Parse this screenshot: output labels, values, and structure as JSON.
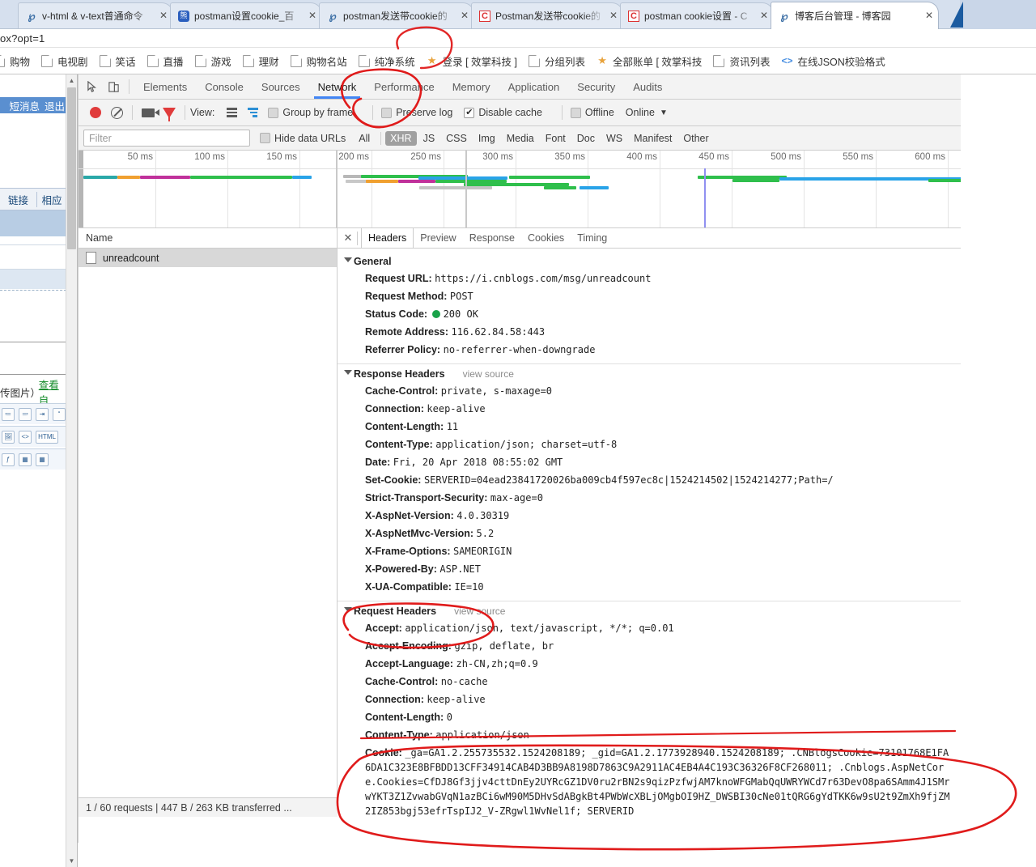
{
  "browser": {
    "tabs": [
      {
        "title": "v-html & v-text普通命令",
        "favicon": "ie-icon",
        "active": false
      },
      {
        "title": "postman设置cookie_百",
        "favicon": "baidu-icon",
        "active": false
      },
      {
        "title": "postman发送带cookie的",
        "favicon": "ie-icon",
        "active": false
      },
      {
        "title": "Postman发送带cookie的",
        "favicon": "csdn-icon",
        "active": false
      },
      {
        "title": "postman cookie设置 - C",
        "favicon": "csdn-icon",
        "active": false
      },
      {
        "title": "博客后台管理 - 博客园",
        "favicon": "ie-icon",
        "active": true
      }
    ],
    "omnibar": {
      "value": "ox?opt=1"
    },
    "bookmarks": [
      {
        "label": "购物",
        "icon": "page-icon"
      },
      {
        "label": "电视剧",
        "icon": "page-icon"
      },
      {
        "label": "笑话",
        "icon": "page-icon"
      },
      {
        "label": "直播",
        "icon": "page-icon"
      },
      {
        "label": "游戏",
        "icon": "page-icon"
      },
      {
        "label": "理财",
        "icon": "page-icon"
      },
      {
        "label": "购物名站",
        "icon": "page-icon"
      },
      {
        "label": "纯净系统",
        "icon": "page-icon"
      },
      {
        "label": "登录 [ 效掌科技 ]",
        "icon": "star-icon"
      },
      {
        "label": "分组列表",
        "icon": "page-icon"
      },
      {
        "label": "全部账单 [ 效掌科技",
        "icon": "star-icon"
      },
      {
        "label": "资讯列表",
        "icon": "page-icon"
      },
      {
        "label": "在线JSON校验格式",
        "icon": "code-icon"
      }
    ]
  },
  "page_behind": {
    "topbar_items": [
      "短消息",
      "退出"
    ],
    "table_headers": [
      "链接",
      "相应"
    ],
    "editor_hint": "传图片）",
    "editor_link": "查看自",
    "editor_tool_labels": [
      "HTML"
    ]
  },
  "devtools": {
    "panel_tabs": [
      {
        "label": "Elements",
        "active": false
      },
      {
        "label": "Console",
        "active": false
      },
      {
        "label": "Sources",
        "active": false
      },
      {
        "label": "Network",
        "active": true
      },
      {
        "label": "Performance",
        "active": false
      },
      {
        "label": "Memory",
        "active": false
      },
      {
        "label": "Application",
        "active": false
      },
      {
        "label": "Security",
        "active": false
      },
      {
        "label": "Audits",
        "active": false
      }
    ],
    "toolbar": {
      "record_label": "record-button",
      "clear_label": "clear-button",
      "capture_screenshots_label": "camera-button",
      "filter_toggle_label": "filter-button",
      "view_label": "View:",
      "group_by_frame": "Group by frame",
      "group_by_frame_checked": false,
      "preserve_log": "Preserve log",
      "preserve_log_checked": false,
      "disable_cache": "Disable cache",
      "disable_cache_checked": true,
      "offline": "Offline",
      "offline_checked": false,
      "throttling": "Online"
    },
    "filterbar": {
      "filter_placeholder": "Filter",
      "filter_value": "",
      "hide_data_urls": "Hide data URLs",
      "hide_data_urls_checked": false,
      "types": [
        {
          "label": "All",
          "active": false
        },
        {
          "label": "XHR",
          "active": true
        },
        {
          "label": "JS",
          "active": false
        },
        {
          "label": "CSS",
          "active": false
        },
        {
          "label": "Img",
          "active": false
        },
        {
          "label": "Media",
          "active": false
        },
        {
          "label": "Font",
          "active": false
        },
        {
          "label": "Doc",
          "active": false
        },
        {
          "label": "WS",
          "active": false
        },
        {
          "label": "Manifest",
          "active": false
        },
        {
          "label": "Other",
          "active": false
        }
      ]
    },
    "overview": {
      "ticks": [
        "50 ms",
        "100 ms",
        "150 ms",
        "200 ms",
        "250 ms",
        "300 ms",
        "350 ms",
        "400 ms",
        "450 ms",
        "500 ms",
        "550 ms",
        "600 ms"
      ]
    },
    "request_list": {
      "column_header": "Name",
      "rows": [
        {
          "name": "unreadcount",
          "selected": true
        }
      ],
      "status_text": "1 / 60 requests  |  447 B / 263 KB transferred  ..."
    },
    "detail_tabs": [
      {
        "label": "Headers",
        "active": true
      },
      {
        "label": "Preview",
        "active": false
      },
      {
        "label": "Response",
        "active": false
      },
      {
        "label": "Cookies",
        "active": false
      },
      {
        "label": "Timing",
        "active": false
      }
    ],
    "headers": {
      "general_title": "General",
      "general": [
        {
          "name": "Request URL:",
          "value": "https://i.cnblogs.com/msg/unreadcount"
        },
        {
          "name": "Request Method:",
          "value": "POST"
        },
        {
          "name": "Status Code:",
          "value": "200 OK",
          "dot": true
        },
        {
          "name": "Remote Address:",
          "value": "116.62.84.58:443"
        },
        {
          "name": "Referrer Policy:",
          "value": "no-referrer-when-downgrade"
        }
      ],
      "response_title": "Response Headers",
      "response_viewsource": "view source",
      "response": [
        {
          "name": "Cache-Control:",
          "value": "private, s-maxage=0"
        },
        {
          "name": "Connection:",
          "value": "keep-alive"
        },
        {
          "name": "Content-Length:",
          "value": "11"
        },
        {
          "name": "Content-Type:",
          "value": "application/json; charset=utf-8"
        },
        {
          "name": "Date:",
          "value": "Fri, 20 Apr 2018 08:55:02 GMT"
        },
        {
          "name": "Set-Cookie:",
          "value": "SERVERID=04ead23841720026ba009cb4f597ec8c|1524214502|1524214277;Path=/"
        },
        {
          "name": "Strict-Transport-Security:",
          "value": "max-age=0"
        },
        {
          "name": "X-AspNet-Version:",
          "value": "4.0.30319"
        },
        {
          "name": "X-AspNetMvc-Version:",
          "value": "5.2"
        },
        {
          "name": "X-Frame-Options:",
          "value": "SAMEORIGIN"
        },
        {
          "name": "X-Powered-By:",
          "value": "ASP.NET"
        },
        {
          "name": "X-UA-Compatible:",
          "value": "IE=10"
        }
      ],
      "request_title": "Request Headers",
      "request_viewsource": "view source",
      "request": [
        {
          "name": "Accept:",
          "value": "application/json, text/javascript, */*; q=0.01"
        },
        {
          "name": "Accept-Encoding:",
          "value": "gzip, deflate, br"
        },
        {
          "name": "Accept-Language:",
          "value": "zh-CN,zh;q=0.9"
        },
        {
          "name": "Cache-Control:",
          "value": "no-cache"
        },
        {
          "name": "Connection:",
          "value": "keep-alive"
        },
        {
          "name": "Content-Length:",
          "value": "0"
        },
        {
          "name": "Content-Type:",
          "value": "application/json"
        }
      ],
      "cookie_name": "Cookie:",
      "cookie_value": "_ga=GA1.2.255735532.1524208189; _gid=GA1.2.1773928940.1524208189; .CNBlogsCookie=73101768E1FA6DA1C323E8BFBDD13CFF34914CAB4D3BB9A8198D7863C9A2911AC4EB4A4C193C36326F8CF268011; .Cnblogs.AspNetCore.Cookies=CfDJ8Gf3jjv4cttDnEy2UYRcGZ1DV0ru2rBN2s9qizPzfwjAM7knoWFGMabQqUWRYWCd7r63DevO8pa6SAmm4J1SMrwYKT3Z1ZvwabGVqN1azBCi6wM90M5DHvSdABgkBt4PWbWcXBLjOMgbOI9HZ_DWSBI30cNe01tQRG6gYdTKK6w9sU2t9ZmXh9fjZM2IZ853bgj53efrTspIJ2_V-ZRgwl1WvNel1f; SERVERID"
    }
  },
  "colors": {
    "accent": "#4285f4",
    "record": "#e03b3b",
    "status_ok": "#1aa34a",
    "annotation": "#e01b1b",
    "tab_active_bg": "#ffffff"
  }
}
